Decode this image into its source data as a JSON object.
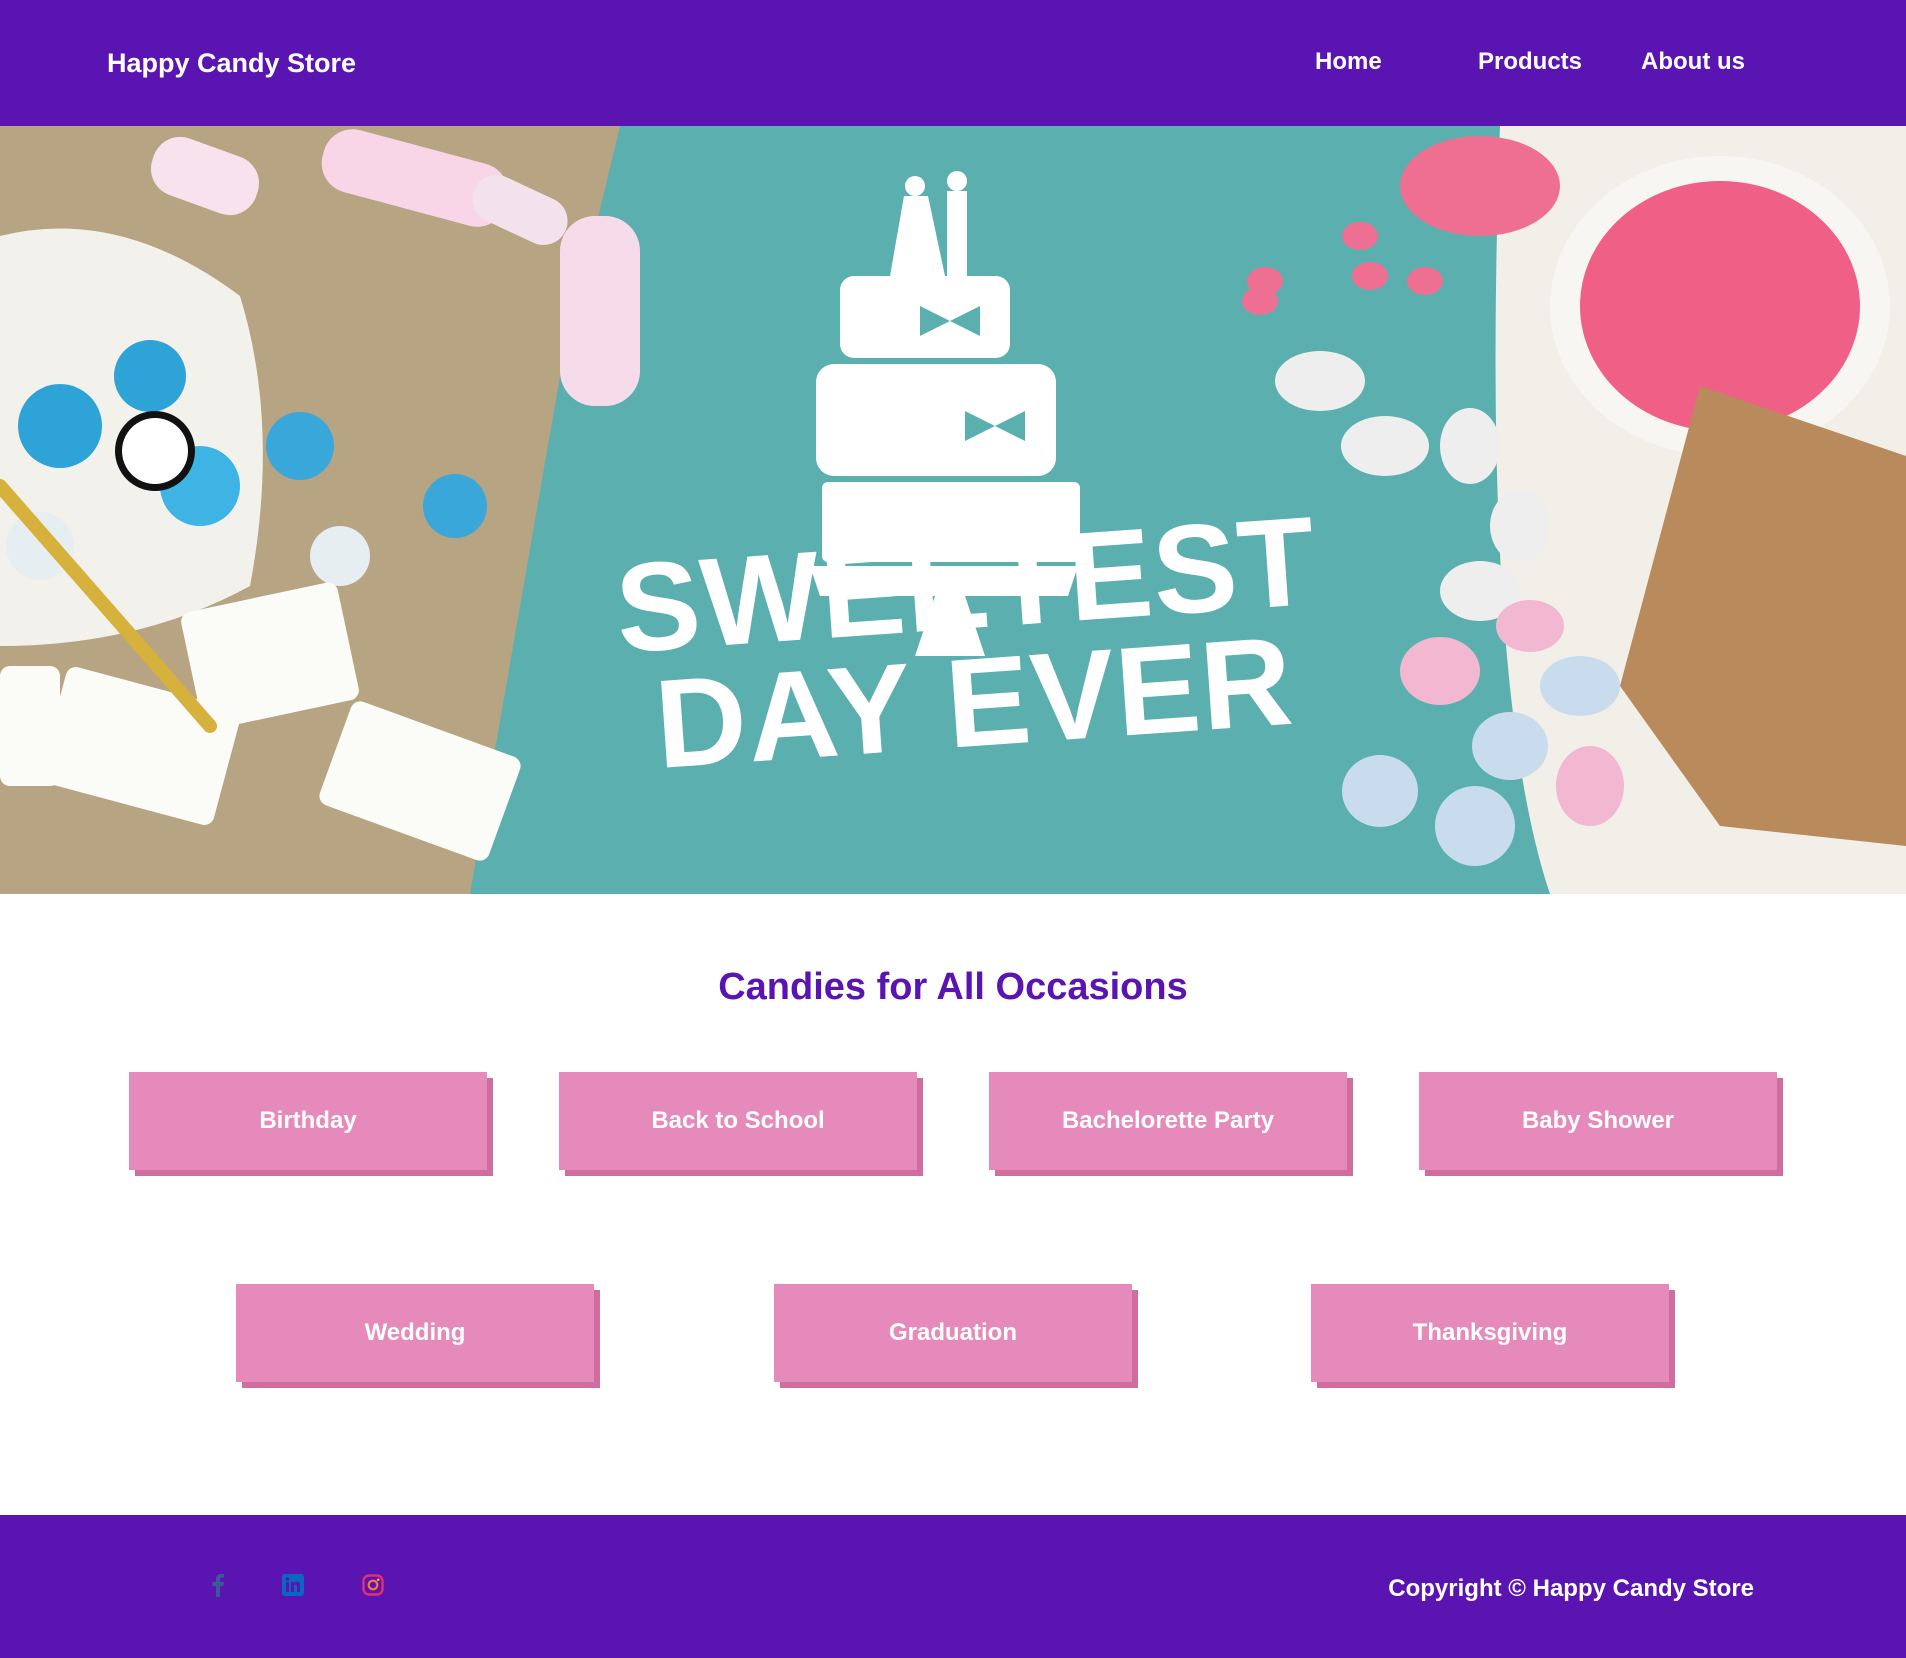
{
  "header": {
    "brand": "Happy Candy Store",
    "nav": [
      {
        "label": "Home"
      },
      {
        "label": "Products"
      },
      {
        "label": "About us"
      }
    ]
  },
  "hero": {
    "line1": "SWEETEST",
    "line2": "DAY EVER",
    "background_color": "#5bb0af"
  },
  "section": {
    "title": "Candies for All Occasions"
  },
  "occasions": [
    {
      "label": "Birthday"
    },
    {
      "label": "Back to School"
    },
    {
      "label": "Bachelorette Party"
    },
    {
      "label": "Baby Shower"
    },
    {
      "label": "Wedding"
    },
    {
      "label": "Graduation"
    },
    {
      "label": "Thanksgiving"
    }
  ],
  "footer": {
    "social": [
      {
        "icon": "facebook-icon"
      },
      {
        "icon": "linkedin-icon"
      },
      {
        "icon": "instagram-icon"
      }
    ],
    "copyright": "Copyright © Happy Candy Store"
  },
  "colors": {
    "brand_purple": "#5a14b1",
    "button_pink": "#e68abb",
    "button_shadow": "#cf6d9f"
  }
}
